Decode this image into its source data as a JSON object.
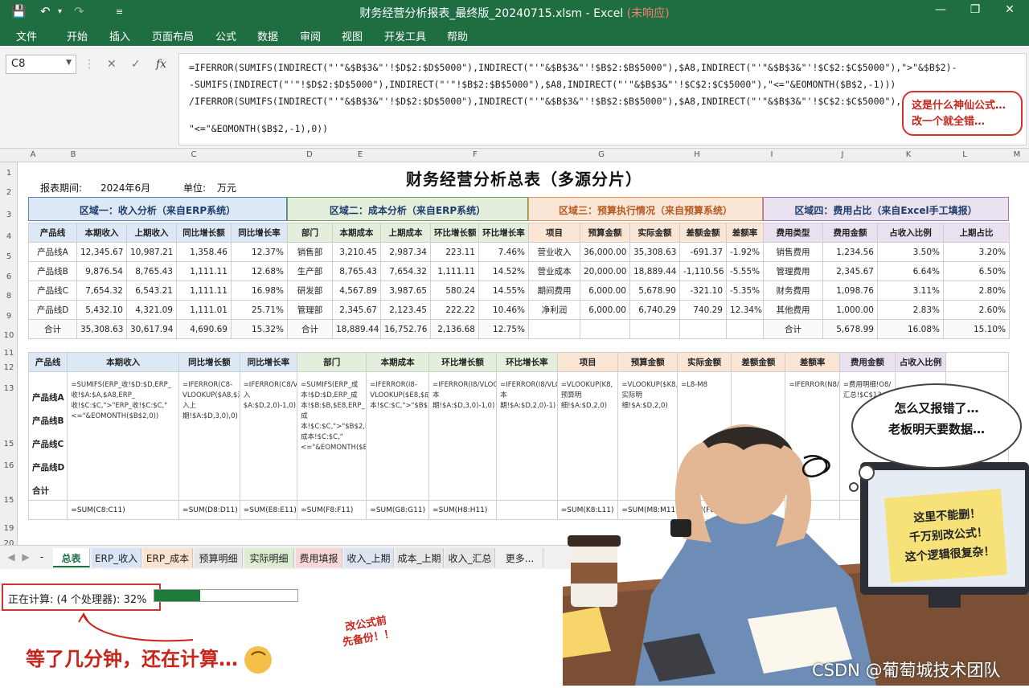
{
  "window": {
    "title": "财务经营分析报表_最终版_20240715.xlsm - Excel",
    "status": "(未响应)"
  },
  "ribbon_tabs": [
    "文件",
    "开始",
    "插入",
    "页面布局",
    "公式",
    "数据",
    "审阅",
    "视图",
    "开发工具",
    "帮助"
  ],
  "formula_bar": {
    "name_box": "C8",
    "fx": "fx",
    "lines": [
      "=IFERROR(SUMIFS(INDIRECT(\"'\"&$B$3&\"'!$D$2:$D$5000\"),INDIRECT(\"'\"&$B$3&\"'!$B$2:$B$5000\"),$A8,INDIRECT(\"'\"&$B$3&\"'!$C$2:$C$5000\"),\">\"&$B$2)-",
      "-SUMIFS(INDIRECT(\"'\"!$D$2:$D$5000\"),INDIRECT(\"'\"!$B$2:$B$5000\"),$A8,INDIRECT(\"'\"&$B$3&\"'!$C$2:$C$5000\"),\"<=\"&EOMONTH($B$2,-1)))",
      "/IFERROR(SUMIFS(INDIRECT(\"'\"&$B$3&\"'!$D$2:$D$5000\"),INDIRECT(\"'\"&$B$3&\"'!$B$2:$B$5000\"),$A8,INDIRECT(\"'\"&$B$3&\"'!$C$2:$C$5000\"),\">/",
      "\"<=\"&EOMONTH($B$2,-1),0))"
    ],
    "bubble_line1": "这是什么神仙公式…",
    "bubble_line2": "改一个就全错…"
  },
  "columns": [
    "A",
    "B",
    "C",
    "D",
    "E",
    "F",
    "G",
    "H",
    "I",
    "J",
    "K",
    "L",
    "M"
  ],
  "rows": [
    "1",
    "2",
    "3",
    "4",
    "5",
    "6",
    "8",
    "9",
    "10",
    "11",
    "12",
    "13",
    "15",
    "16",
    "15",
    "19",
    "20"
  ],
  "sheet": {
    "title": "财务经营分析总表（多源分片）",
    "period_label": "报表期间:",
    "period_value": "2024年6月",
    "unit_label": "单位:",
    "unit_value": "万元",
    "sections": [
      {
        "title": "区域一：收入分析（来自ERP系统）",
        "color": "#dde8f6",
        "border": "#5b82c0"
      },
      {
        "title": "区域二：成本分析（来自ERP系统）",
        "color": "#e3efdc",
        "border": "#6fa055"
      },
      {
        "title": "区域三：预算执行情况（来自预算系统）",
        "color": "#fbe6d6",
        "border": "#e0925a"
      },
      {
        "title": "区域四：费用占比（来自Excel手工填报）",
        "color": "#e9e0f0",
        "border": "#9a76b8"
      }
    ],
    "t1": {
      "headers": [
        "产品线",
        "本期收入",
        "上期收入",
        "同比增长额",
        "同比增长率"
      ],
      "rows": [
        [
          "产品线A",
          "12,345.67",
          "10,987.21",
          "1,358.46",
          "12.37%"
        ],
        [
          "产品线B",
          "9,876.54",
          "8,765.43",
          "1,111.11",
          "12.68%"
        ],
        [
          "产品线C",
          "7,654.32",
          "6,543.21",
          "1,111.11",
          "16.98%"
        ],
        [
          "产品线D",
          "5,432.10",
          "4,321.09",
          "1,111.01",
          "25.71%"
        ],
        [
          "合计",
          "35,308.63",
          "30,617.94",
          "4,690.69",
          "15.32%"
        ]
      ]
    },
    "t2": {
      "headers": [
        "部门",
        "本期成本",
        "上期成本",
        "环比增长额",
        "环比增长率"
      ],
      "rows": [
        [
          "销售部",
          "3,210.45",
          "2,987.34",
          "223.11",
          "7.46%"
        ],
        [
          "生产部",
          "8,765.43",
          "7,654.32",
          "1,111.11",
          "14.52%"
        ],
        [
          "研发部",
          "4,567.89",
          "3,987.65",
          "580.24",
          "14.55%"
        ],
        [
          "管理部",
          "2,345.67",
          "2,123.45",
          "222.22",
          "10.46%"
        ],
        [
          "合计",
          "18,889.44",
          "16,752.76",
          "2,136.68",
          "12.75%"
        ]
      ]
    },
    "t3": {
      "headers": [
        "项目",
        "预算金额",
        "实际金额",
        "差额金额",
        "差额率"
      ],
      "rows": [
        [
          "营业收入",
          "36,000.00",
          "35,308.63",
          "-691.37",
          "-1.92%"
        ],
        [
          "营业成本",
          "20,000.00",
          "18,889.44",
          "-1,110.56",
          "-5.55%"
        ],
        [
          "期间费用",
          "6,000.00",
          "5,678.90",
          "-321.10",
          "-5.35%"
        ],
        [
          "净利润",
          "6,000.00",
          "6,740.29",
          "740.29",
          "12.34%"
        ],
        [
          "",
          "",
          "",
          "",
          ""
        ]
      ]
    },
    "t4": {
      "headers": [
        "费用类型",
        "费用金额",
        "占收入比例",
        "上期占比"
      ],
      "rows": [
        [
          "销售费用",
          "1,234.56",
          "3.50%",
          "3.20%"
        ],
        [
          "管理费用",
          "2,345.67",
          "6.64%",
          "6.50%"
        ],
        [
          "财务费用",
          "1,098.76",
          "3.11%",
          "2.80%"
        ],
        [
          "其他费用",
          "1,000.00",
          "2.83%",
          "2.60%"
        ],
        [
          "合计",
          "5,678.99",
          "16.08%",
          "15.10%"
        ]
      ]
    },
    "lower": {
      "headers": [
        "产品线",
        "本期收入",
        "同比增长额",
        "同比增长率",
        "部门",
        "本期成本",
        "环比增长额",
        "环比增长率",
        "项目",
        "预算金额",
        "实际金额",
        "差额金额",
        "差额率",
        "费用金额",
        "占收入比例"
      ],
      "labels": [
        "产品线A",
        "产品线B",
        "产品线C",
        "产品线D",
        "合计"
      ],
      "formulas": [
        "=SUMIFS(ERP_收!$D:$D,ERP_收!$A:$A,$A8,ERP_收!$C:$C,\">\"ERP_收!$C:$C,\"<=\"&EOMONTH($B$2,0))",
        "=IFERROR(C8-VLOOKUP($A8,$汇入上期!$A:$D,3,0),0)",
        "=IFERROR(C8/VLOOKUP($A8,$汇入$A:$D,2,0)-1,0)",
        "=SUMIFS(ERP_成本!$D:$D,ERP_成本!$B:$B,$E8,ERP_成本!$C:$C,\">\"$B$2,ERP_成本!$C:$C,\"<=\"&EOMONTH($B$2,0))",
        "=IFERROR(I8-VLOOKUP($E8,$成本!$C:$C,\">\"$B$2,0)",
        "=IFERROR(I8/VLOOKUP($E8,$成本期!$A:$D,3,0)-1,0)",
        "=IFERROR(I8/VLOOKUP($E8,$成本期!$A:$D,2,0)-1)",
        "=VLOOKUP(K8,预算明细!$A:$D,2,0)",
        "=VLOOKUP($K8,实际明细!$A:$D,2,0)",
        "=L8-M8",
        "",
        "=IFERROR(N8/L8,0)",
        "=费用明细!O8/汇总!$C$13",
        ""
      ],
      "sums": [
        "=SUM(C8:C11)",
        "=SUM(D8:D11)",
        "=SUM(E8:E11)",
        "=SUM(F8:F11)",
        "=SUM(G8:G11)",
        "=SUM(H8:H11)",
        "=SUM(K8:L11)",
        "=SUM(M8:M11)",
        "=SUM(F8:F"
      ]
    }
  },
  "sheet_tabs": [
    "总表",
    "ERP_收入",
    "ERP_成本",
    "预算明细",
    "实际明细",
    "费用填报",
    "收入_上期",
    "成本_上期",
    "收入_汇总",
    "更多..."
  ],
  "status": {
    "calc_text": "正在计算: (4 个处理器): 32%",
    "progress": 0.32,
    "caption": "等了几分钟，还在计算…"
  },
  "scene": {
    "thought_line1": "怎么又报错了…",
    "thought_line2": "老板明天要数据…",
    "note_monitor_1": "这里不能删！",
    "note_monitor_2": "千万别改公式！",
    "note_monitor_3": "这个逻辑很复杂！",
    "note_desk_1": "改公式前",
    "note_desk_2": "先备份！！"
  },
  "watermark": "CSDN @葡萄城技术团队"
}
